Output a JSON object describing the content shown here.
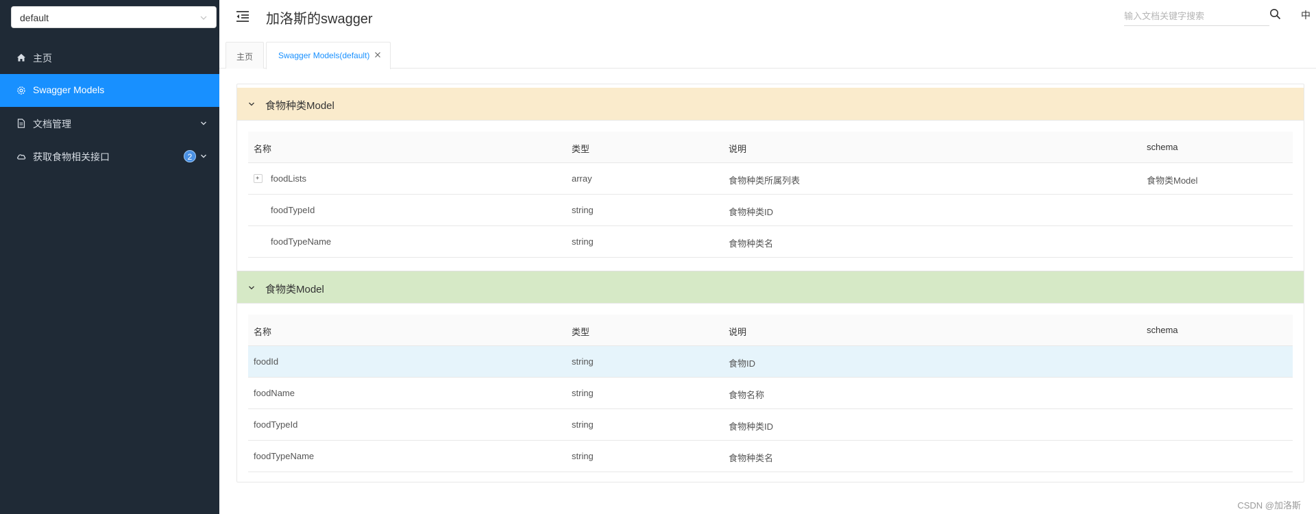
{
  "sidebar": {
    "group_select": {
      "value": "default"
    },
    "menu": [
      {
        "label": "主页",
        "icon": "home-icon",
        "active": false
      },
      {
        "label": "Swagger Models",
        "icon": "settings-icon",
        "active": true
      },
      {
        "label": "文档管理",
        "icon": "document-icon",
        "active": false
      },
      {
        "label": "获取食物相关接口",
        "icon": "cloud-icon",
        "active": false,
        "badge": "2"
      }
    ]
  },
  "header": {
    "title": "加洛斯的swagger",
    "search_placeholder": "输入文档关键字搜索",
    "lang": "中"
  },
  "tabs": [
    {
      "label": "主页",
      "active": false
    },
    {
      "label": "Swagger Models(default)",
      "active": true
    }
  ],
  "columns": [
    "名称",
    "类型",
    "说明",
    "schema"
  ],
  "models": [
    {
      "title": "食物种类Model",
      "header_color": "#faebcc",
      "rows": [
        {
          "name": "foodLists",
          "type": "array",
          "desc": "食物种类所属列表",
          "schema": "食物类Model",
          "expandable": true
        },
        {
          "name": "foodTypeId",
          "type": "string",
          "desc": "食物种类ID",
          "schema": ""
        },
        {
          "name": "foodTypeName",
          "type": "string",
          "desc": "食物种类名",
          "schema": ""
        }
      ]
    },
    {
      "title": "食物类Model",
      "header_color": "#d6e9c6",
      "rows": [
        {
          "name": "foodId",
          "type": "string",
          "desc": "食物ID",
          "schema": "",
          "highlight": true
        },
        {
          "name": "foodName",
          "type": "string",
          "desc": "食物名称",
          "schema": ""
        },
        {
          "name": "foodTypeId",
          "type": "string",
          "desc": "食物种类ID",
          "schema": ""
        },
        {
          "name": "foodTypeName",
          "type": "string",
          "desc": "食物种类名",
          "schema": ""
        }
      ]
    }
  ],
  "watermark": "CSDN @加洛斯",
  "colors": {
    "sidebar_bg": "#1f2a36",
    "accent": "#1890ff",
    "highlight_row": "#e6f4fb"
  }
}
